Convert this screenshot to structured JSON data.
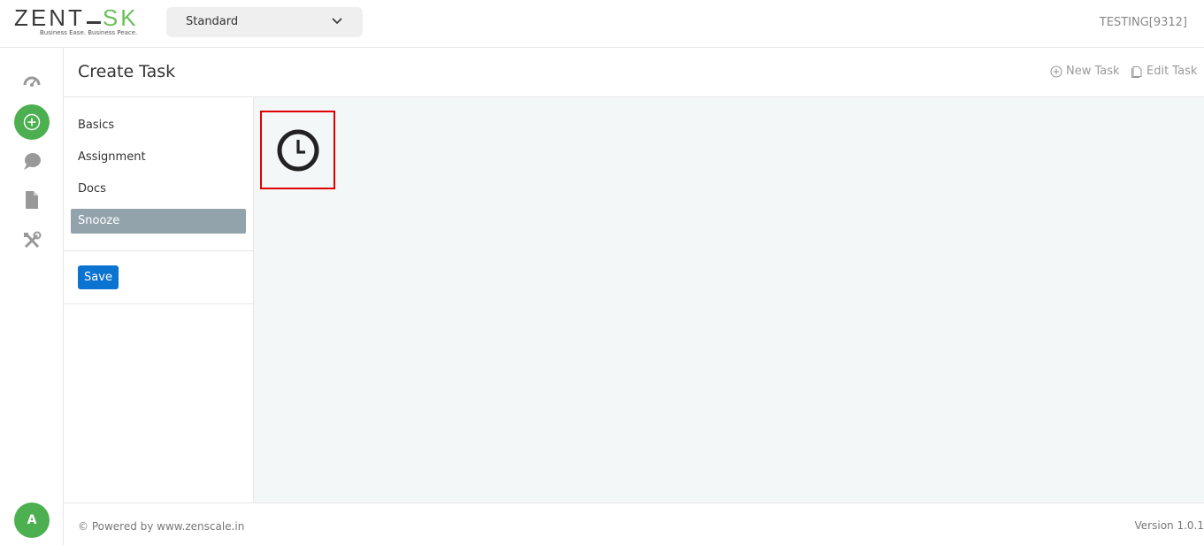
{
  "header": {
    "logo_prefix": "ZEN",
    "logo_mid": "T",
    "logo_suffix": "SK",
    "logo_tagline": "Business Ease. Business Peace.",
    "dropdown_value": "Standard",
    "user_label": "TESTING[9312]"
  },
  "rail": {
    "icons": [
      "dashboard-gauge-icon",
      "add-icon",
      "chat-bubble-icon",
      "document-icon",
      "tools-icon"
    ],
    "avatar_letter": "A"
  },
  "page": {
    "title": "Create Task",
    "new_task_label": "New Task",
    "edit_task_label": "Edit Task"
  },
  "tabs": {
    "items": [
      "Basics",
      "Assignment",
      "Docs",
      "Snooze"
    ],
    "active": "Snooze",
    "save_label": "Save"
  },
  "content": {
    "icon": "clock-icon",
    "highlight_color": "#e00000"
  },
  "footer": {
    "powered_by": "© Powered by www.zenscale.in",
    "version": "Version 1.0.1"
  },
  "colors": {
    "accent_green": "#4caf50",
    "primary_blue": "#0b74d1",
    "active_tab": "#93a3ab"
  }
}
